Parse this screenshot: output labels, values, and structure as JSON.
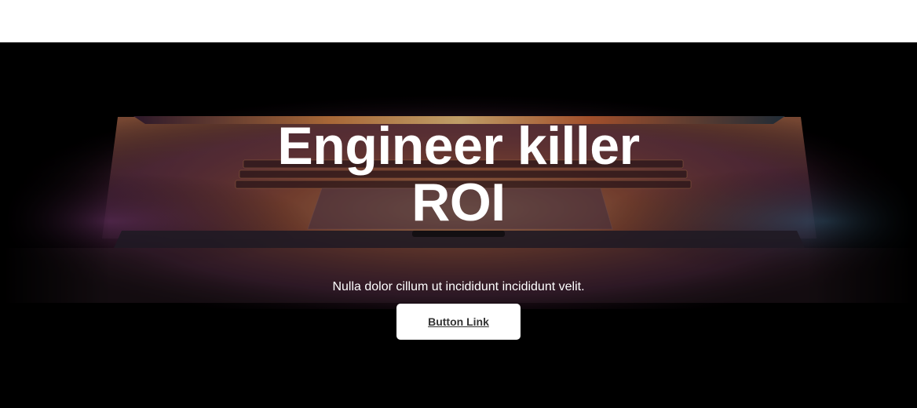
{
  "hero": {
    "title_line1": "Engineer killer",
    "title_line2": "ROI",
    "subtitle": "Nulla dolor cillum ut incididunt incididunt velit.",
    "button_label": "Button Link"
  },
  "colors": {
    "background": "#000000",
    "text": "#ffffff",
    "button_bg": "#ffffff",
    "button_text": "#333333"
  }
}
